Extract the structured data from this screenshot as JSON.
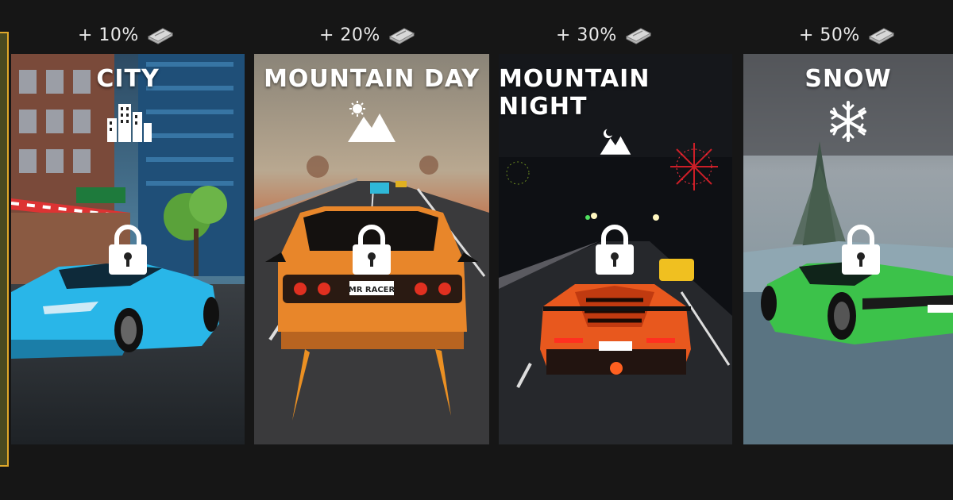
{
  "levels": [
    {
      "title": "CITY",
      "bonus": "+ 10%",
      "theme_icon": "city-buildings-icon",
      "locked": true,
      "car_color": "#29b6e8"
    },
    {
      "title": "MOUNTAIN DAY",
      "bonus": "+ 20%",
      "theme_icon": "mountain-sun-icon",
      "locked": true,
      "car_color": "#e8862a",
      "plate": "MR RACER"
    },
    {
      "title": "MOUNTAIN NIGHT",
      "bonus": "+ 30%",
      "theme_icon": "mountain-moon-icon",
      "locked": true,
      "car_color": "#e8581e"
    },
    {
      "title": "SNOW",
      "bonus": "+ 50%",
      "theme_icon": "snowflake-icon",
      "locked": true,
      "car_color": "#3cc24a"
    }
  ],
  "colors": {
    "background": "#161616",
    "selection_frame": "#e0a82a",
    "text": "#ffffff"
  },
  "icons": {
    "bonus": "cash-stack-icon",
    "lock": "padlock-icon"
  }
}
